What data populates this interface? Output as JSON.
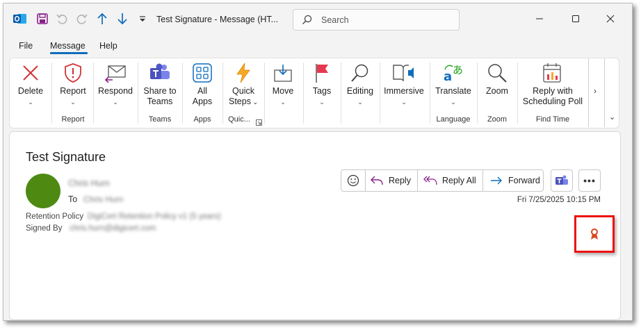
{
  "titlebar": {
    "title": "Test Signature  -  Message (HT...",
    "search_placeholder": "Search"
  },
  "menu": {
    "tabs": [
      {
        "label": "File"
      },
      {
        "label": "Message",
        "active": true
      },
      {
        "label": "Help"
      }
    ]
  },
  "ribbon": {
    "buttons": {
      "delete": "Delete",
      "report": "Report",
      "respond": "Respond",
      "share_teams": [
        "Share to",
        "Teams"
      ],
      "all_apps": [
        "All",
        "Apps"
      ],
      "quick_steps": [
        "Quick",
        "Steps"
      ],
      "move": "Move",
      "tags": "Tags",
      "editing": "Editing",
      "immersive": "Immersive",
      "translate": "Translate",
      "zoom": "Zoom",
      "reply_poll": [
        "Reply with",
        "Scheduling Poll"
      ]
    },
    "group_labels": {
      "report": "Report",
      "teams": "Teams",
      "apps": "Apps",
      "quick": "Quic...",
      "language": "Language",
      "zoom": "Zoom",
      "find_time": "Find Time"
    },
    "more_glyph": "›",
    "collapse_glyph": "⌄"
  },
  "message": {
    "subject": "Test Signature",
    "sender": "Chris Hurn",
    "to_label": "To",
    "to_value": "Chris Hurn",
    "retention_label": "Retention Policy",
    "retention_value": "DigiCert Retention Policy v1 (5 years)",
    "signed_label": "Signed By",
    "signed_value": "chris.hurn@digicert.com",
    "date": "Fri 7/25/2025 10:15 PM",
    "actions": {
      "reply": "Reply",
      "reply_all": "Reply All",
      "forward": "Forward",
      "more": "•••"
    }
  },
  "colors": {
    "accent": "#0f6cbd",
    "avatar": "#4e8a12",
    "highlight": "#ee1111",
    "signature_icon": "#d9481c"
  }
}
